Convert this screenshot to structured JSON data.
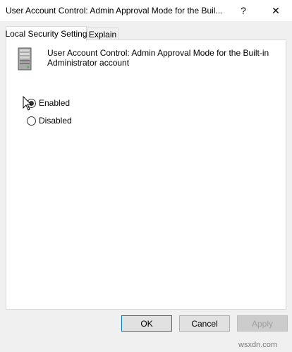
{
  "window": {
    "title": "User Account Control: Admin Approval Mode for the Buil...",
    "help_label": "?",
    "close_label": "✕"
  },
  "tabs": [
    {
      "label": "Local Security Setting",
      "active": true
    },
    {
      "label": "Explain",
      "active": false
    }
  ],
  "panel": {
    "icon": "server-icon",
    "policy_name": "User Account Control: Admin Approval Mode for the Built-in Administrator account",
    "options": [
      {
        "label": "Enabled",
        "selected": true
      },
      {
        "label": "Disabled",
        "selected": false
      }
    ]
  },
  "buttons": {
    "ok": "OK",
    "cancel": "Cancel",
    "apply": "Apply"
  },
  "watermark": "wsxdn.com",
  "colors": {
    "accent": "#0078d7",
    "background": "#f0f0f0",
    "panel": "#ffffff"
  }
}
